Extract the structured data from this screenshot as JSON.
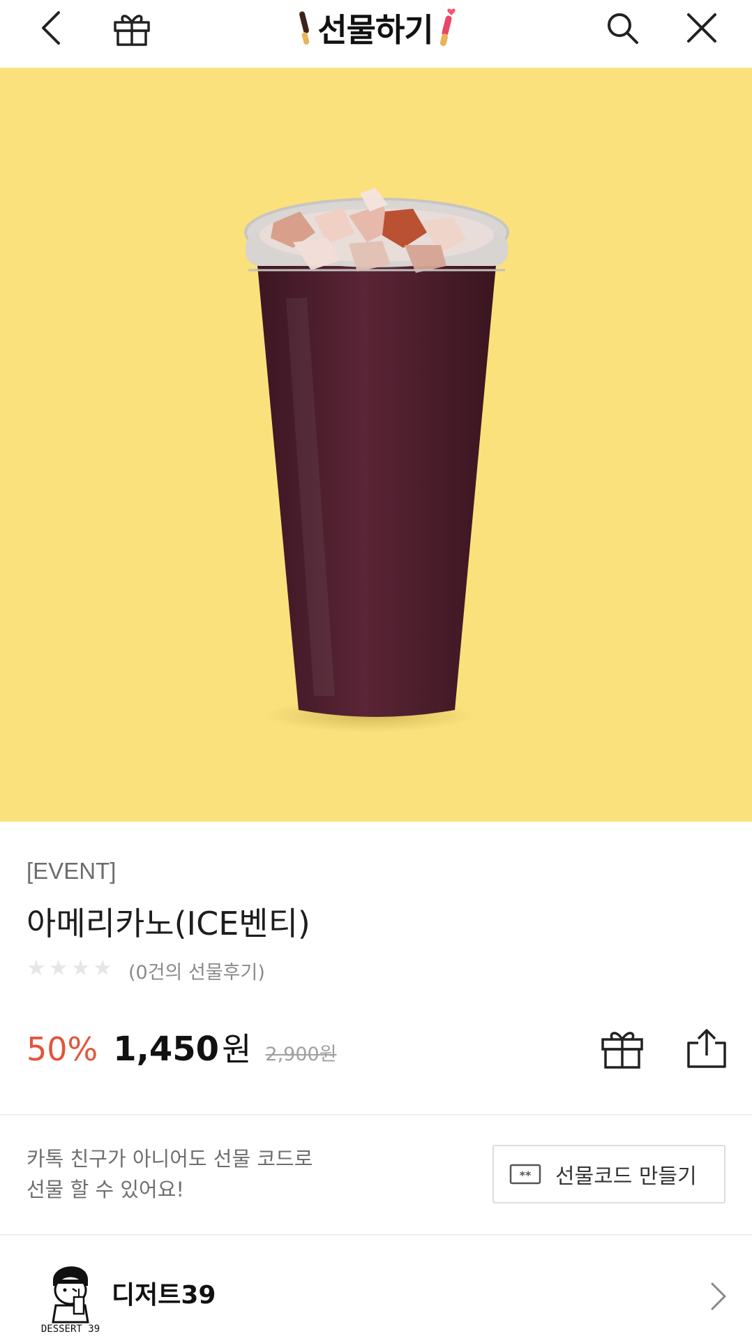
{
  "header": {
    "title": "선물하기",
    "icons": [
      "back-icon",
      "gift-box-icon",
      "search-icon",
      "close-icon"
    ]
  },
  "product": {
    "tag": "[EVENT]",
    "name": "아메리카노(ICE벤티)",
    "rating": 0,
    "review_count_text": "(0건의 선물후기)",
    "discount": "50%",
    "price": "1,450",
    "currency": "원",
    "original_price": "2,900원"
  },
  "gift_code": {
    "description_line1": "카톡 친구가 아니어도 선물 코드로",
    "description_line2": "선물 할 수 있어요!",
    "button_label": "선물코드 만들기"
  },
  "brand": {
    "name": "디저트39",
    "logo_text": "DESSERT 39"
  },
  "colors": {
    "hero_bg": "#fbe17c",
    "discount": "#e4543a",
    "coffee": "#4a1f2a"
  }
}
